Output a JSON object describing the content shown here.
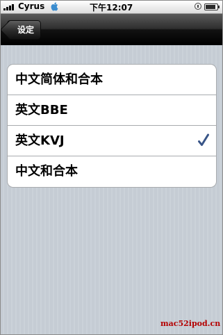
{
  "status_bar": {
    "carrier": "Cyrus",
    "time": "下午12:07"
  },
  "nav": {
    "back_label": "设定"
  },
  "options": [
    {
      "label": "中文简体和合本",
      "selected": false
    },
    {
      "label": "英文BBE",
      "selected": false
    },
    {
      "label": "英文KVJ",
      "selected": true
    },
    {
      "label": "中文和合本",
      "selected": false
    }
  ],
  "colors": {
    "checkmark": "#385487",
    "background": "#c5ccd4",
    "nav_bar": "#000000"
  },
  "watermark": "mac52ipod.cn"
}
